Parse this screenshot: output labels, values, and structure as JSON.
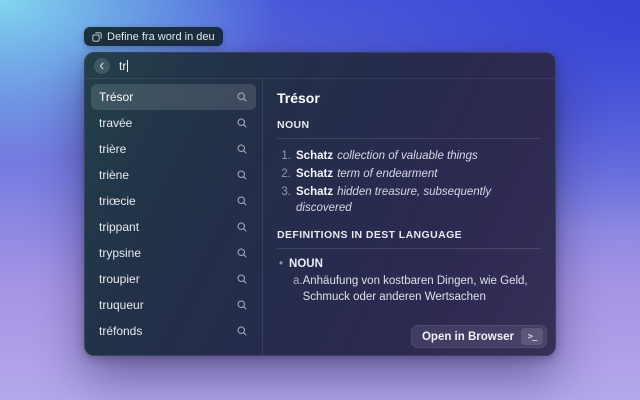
{
  "colors": {
    "bg_top_left": "#82d7f0",
    "bg_top_right": "#3643d5",
    "bg_bottom": "#b2a4e9",
    "window_teal": "#21404a",
    "window_purple": "#373059",
    "selection_highlight": "rgba(255,255,255,0.13)"
  },
  "badge": {
    "label": "Define fra word in deu"
  },
  "search": {
    "query": "tr",
    "back_icon": "‹"
  },
  "list": {
    "items": [
      {
        "label": "Trésor",
        "selected": true
      },
      {
        "label": "travée",
        "selected": false
      },
      {
        "label": "trière",
        "selected": false
      },
      {
        "label": "triène",
        "selected": false
      },
      {
        "label": "triœcie",
        "selected": false
      },
      {
        "label": "trippant",
        "selected": false
      },
      {
        "label": "trypsine",
        "selected": false
      },
      {
        "label": "troupier",
        "selected": false
      },
      {
        "label": "truqueur",
        "selected": false
      },
      {
        "label": "tréfonds",
        "selected": false
      }
    ]
  },
  "detail": {
    "title": "Trésor",
    "pos_header": "NOUN",
    "noun_entries": [
      {
        "num": "1.",
        "word": "Schatz",
        "text": "collection of valuable things"
      },
      {
        "num": "2.",
        "word": "Schatz",
        "text": "term of endearment"
      },
      {
        "num": "3.",
        "word": "Schatz",
        "text": "hidden treasure, subsequently discovered"
      }
    ],
    "dest_header": "DEFINITIONS IN DEST LANGUAGE",
    "dest_bullet": "•",
    "dest_pos": "NOUN",
    "dest_entries": [
      {
        "letter": "a.",
        "text": "Anhäufung von kostbaren Dingen, wie Geld, Schmuck oder anderen Wertsachen"
      }
    ]
  },
  "footer": {
    "action_label": "Open in Browser",
    "shortcut_glyph": ">_"
  }
}
